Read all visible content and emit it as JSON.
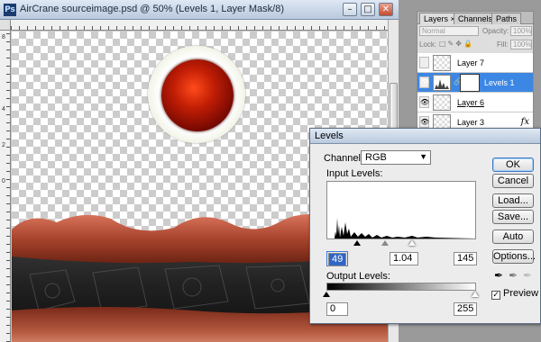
{
  "document": {
    "title": "AirCrane sourceimage.psd @ 50% (Levels 1, Layer Mask/8)",
    "app_icon": "Ps",
    "ruler_left_labels": [
      "8",
      "4",
      "2",
      "0"
    ]
  },
  "levels_dialog": {
    "title": "Levels",
    "channel_label": "Channel:",
    "channel_value": "RGB",
    "input_levels_label": "Input Levels:",
    "input_black": "49",
    "input_gamma": "1.04",
    "input_white": "145",
    "output_levels_label": "Output Levels:",
    "output_black": "0",
    "output_white": "255",
    "buttons": {
      "ok": "OK",
      "cancel": "Cancel",
      "load": "Load...",
      "save": "Save...",
      "auto": "Auto",
      "options": "Options..."
    },
    "preview_label": "Preview",
    "preview_checked": true
  },
  "layers_panel": {
    "tabs": [
      "Layers ×",
      "Channels",
      "Paths"
    ],
    "blend_mode": "Normal",
    "opacity_label": "Opacity:",
    "opacity_value": "100%",
    "lock_label": "Lock:",
    "fill_label": "Fill:",
    "fill_value": "100%",
    "layers": [
      {
        "name": "Layer 7",
        "visible": false,
        "selected": false
      },
      {
        "name": "Levels 1",
        "visible": true,
        "selected": true
      },
      {
        "name": "Layer 6",
        "visible": true,
        "selected": false
      },
      {
        "name": "Layer 3",
        "visible": true,
        "selected": false,
        "fx": "fx"
      }
    ]
  }
}
